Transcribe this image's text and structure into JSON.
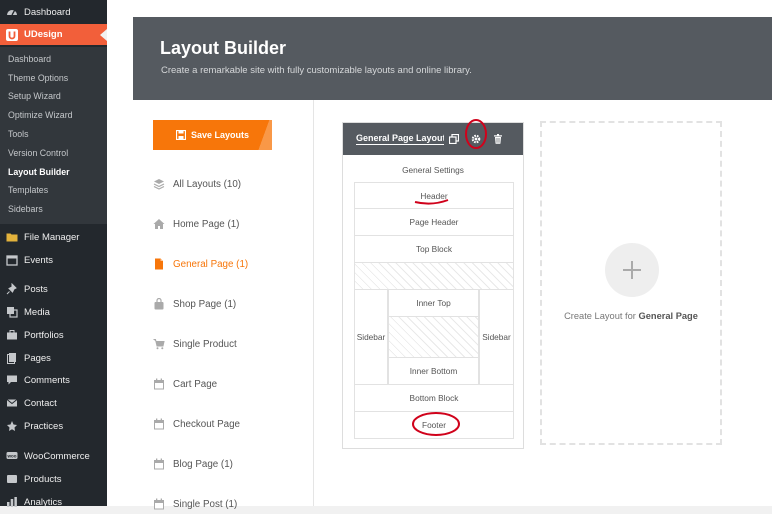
{
  "sidebar": {
    "top_items": [
      {
        "label": "Dashboard",
        "icon": "dashboard-icon"
      },
      {
        "label": "UDesign",
        "icon": "udesign-logo-icon"
      }
    ],
    "submenu": [
      "Dashboard",
      "Theme Options",
      "Setup Wizard",
      "Optimize Wizard",
      "Tools",
      "Version Control",
      "Layout Builder",
      "Templates",
      "Sidebars"
    ],
    "current_submenu": "Layout Builder",
    "items": [
      {
        "label": "File Manager",
        "icon": "folder-icon"
      },
      {
        "label": "Events",
        "icon": "calendar-icon"
      },
      {
        "label": "Posts",
        "icon": "pin-icon"
      },
      {
        "label": "Media",
        "icon": "media-icon"
      },
      {
        "label": "Portfolios",
        "icon": "portfolio-icon"
      },
      {
        "label": "Pages",
        "icon": "pages-icon"
      },
      {
        "label": "Comments",
        "icon": "comments-icon"
      },
      {
        "label": "Contact",
        "icon": "mail-icon"
      },
      {
        "label": "Practices",
        "icon": "practices-icon"
      },
      {
        "label": "WooCommerce",
        "icon": "woocommerce-icon"
      },
      {
        "label": "Products",
        "icon": "products-icon"
      },
      {
        "label": "Analytics",
        "icon": "analytics-icon"
      }
    ],
    "accent": "#f25f3a"
  },
  "header": {
    "title": "Layout Builder",
    "subtitle": "Create a remarkable site with fully customizable layouts and online library."
  },
  "categories": {
    "save_label": "Save Layouts",
    "items": [
      {
        "label": "All Layouts (10)",
        "icon": "stack-icon"
      },
      {
        "label": "Home Page (1)",
        "icon": "home-icon"
      },
      {
        "label": "General Page (1)",
        "icon": "page-icon"
      },
      {
        "label": "Shop Page (1)",
        "icon": "shop-bag-icon"
      },
      {
        "label": "Single Product",
        "icon": "cart-icon"
      },
      {
        "label": "Cart Page",
        "icon": "calendar-icon"
      },
      {
        "label": "Checkout Page",
        "icon": "calendar-icon"
      },
      {
        "label": "Blog Page (1)",
        "icon": "calendar-icon"
      },
      {
        "label": "Single Post (1)",
        "icon": "calendar-icon"
      }
    ],
    "active": "General Page (1)",
    "accent": "#f7760a"
  },
  "layout_card": {
    "title": "General Page Layout",
    "general_settings": "General Settings",
    "header": "Header",
    "page_header": "Page Header",
    "top_block": "Top Block",
    "inner_top": "Inner Top",
    "sidebar_left": "Sidebar",
    "sidebar_right": "Sidebar",
    "inner_bottom": "Inner Bottom",
    "bottom_block": "Bottom Block",
    "footer": "Footer"
  },
  "create": {
    "prefix": "Create Layout for ",
    "target": "General Page"
  }
}
